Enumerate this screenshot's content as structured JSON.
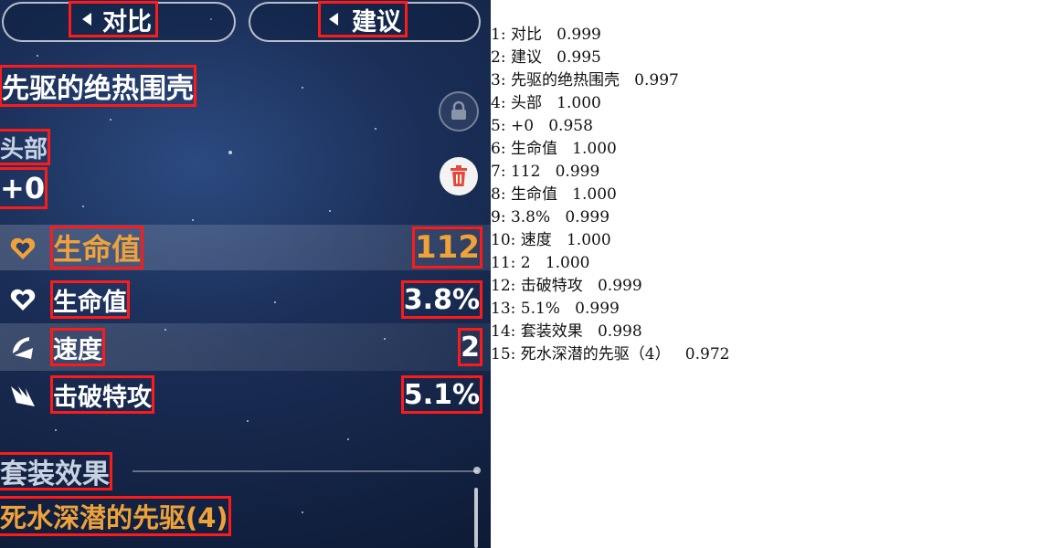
{
  "game": {
    "compare_btn": "对比",
    "suggest_btn": "建议",
    "item_title": "先驱的绝热围壳",
    "slot": "头部",
    "level": "+0",
    "main_stat": {
      "label": "生命值",
      "value": "112"
    },
    "sub_stats": [
      {
        "label": "生命值",
        "value": "3.8%",
        "icon": "heart-icon"
      },
      {
        "label": "速度",
        "value": "2",
        "icon": "speed-icon"
      },
      {
        "label": "击破特攻",
        "value": "5.1%",
        "icon": "break-icon"
      }
    ],
    "set_effect_label": "套装效果",
    "set_name": "死水深潜的先驱(4)"
  },
  "ocr_results": [
    "1: 对比   0.999",
    "2: 建议   0.995",
    "3: 先驱的绝热围壳   0.997",
    "4: 头部   1.000",
    "5: +0   0.958",
    "6: 生命值   1.000",
    "7: 112   0.999",
    "8: 生命值   1.000",
    "9: 3.8%   0.999",
    "10: 速度   1.000",
    "11: 2   1.000",
    "12: 击破特攻   0.999",
    "13: 5.1%   0.999",
    "14: 套装效果   0.998",
    "15: 死水深潜的先驱（4）   0.972"
  ],
  "colors": {
    "highlight": "#f0a23a",
    "box": "#ff1a1a"
  }
}
